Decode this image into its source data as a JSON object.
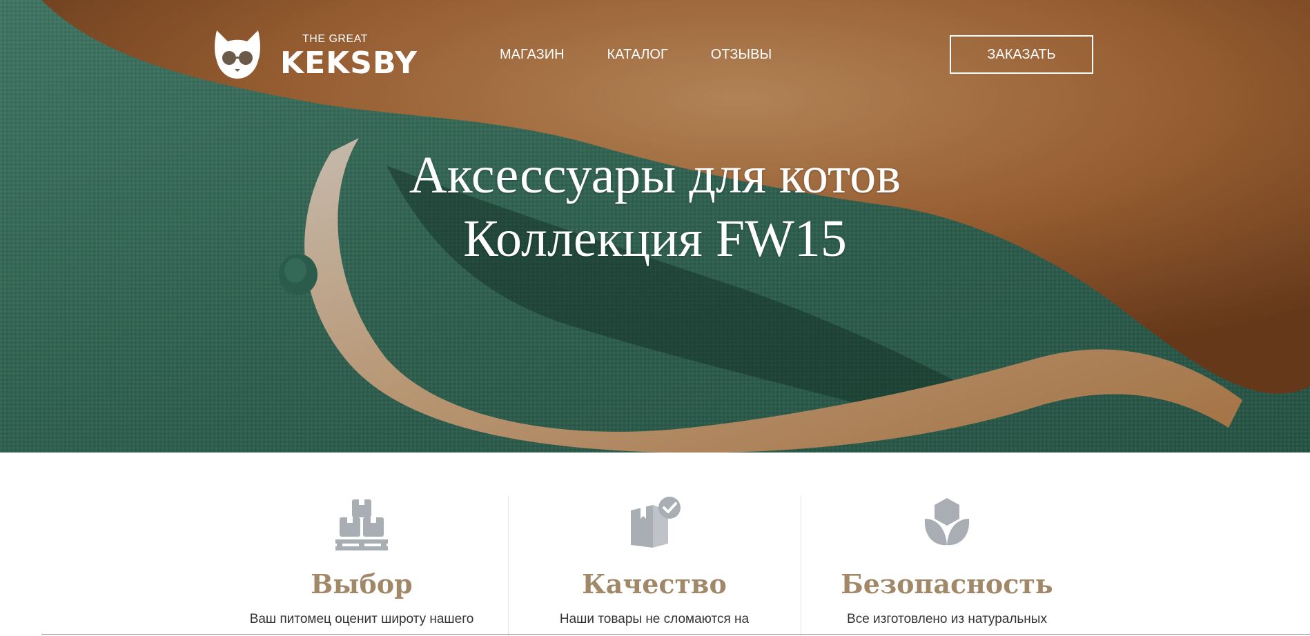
{
  "header": {
    "logo_small": "THE GREAT",
    "logo_big": "KEKSBY",
    "nav": [
      "МАГАЗИН",
      "КАТАЛОГ",
      "ОТЗЫВЫ"
    ],
    "order_button": "ЗАКАЗАТЬ"
  },
  "hero": {
    "title_line1": "Аксессуары для котов",
    "title_line2": "Коллекция FW15",
    "background_image": "ginger-cat-tail-on-green-sofa"
  },
  "features": [
    {
      "icon": "pallet-boxes-icon",
      "title": "Выбор",
      "text": "Ваш питомец оценит широту нашего"
    },
    {
      "icon": "box-check-icon",
      "title": "Качество",
      "text": "Наши товары не сломаются на"
    },
    {
      "icon": "lotus-leaf-icon",
      "title": "Безопасность",
      "text": "Все изготовлено из натуральных"
    }
  ],
  "colors": {
    "accent": "#a08869",
    "icon_gray": "#a9aeb4",
    "sofa_green": "#3f7a66",
    "cat_orange": "#c9864a"
  }
}
